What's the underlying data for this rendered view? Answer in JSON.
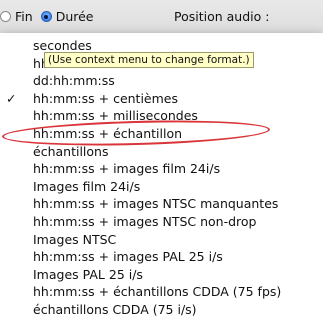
{
  "toolbar": {
    "radio_fin": "Fin",
    "radio_duree": "Durée",
    "position_label": "Position audio :"
  },
  "tooltip": "(Use context menu to change format.)",
  "menu": {
    "selected_index": 3,
    "items": [
      "secondes",
      "hh:mm:ss",
      "dd:hh:mm:ss",
      "hh:mm:ss + centièmes",
      "hh:mm:ss + millisecondes",
      "hh:mm:ss + échantillon",
      "échantillons",
      "hh:mm:ss + images film 24i/s",
      "Images film 24i/s",
      "hh:mm:ss + images NTSC manquantes",
      "hh:mm:ss + images NTSC non-drop",
      "Images NTSC",
      "hh:mm:ss + images PAL 25 i/s",
      "Images PAL 25 i/s",
      "hh:mm:ss + échantillons CDDA (75 fps)",
      "échantillons CDDA (75 i/s)"
    ]
  },
  "icons": {
    "check": "checkmark-icon"
  },
  "colors": {
    "highlight": "#d9353a",
    "tooltip_bg": "#ffffc7",
    "radio_selected": "#1c6fe0"
  }
}
